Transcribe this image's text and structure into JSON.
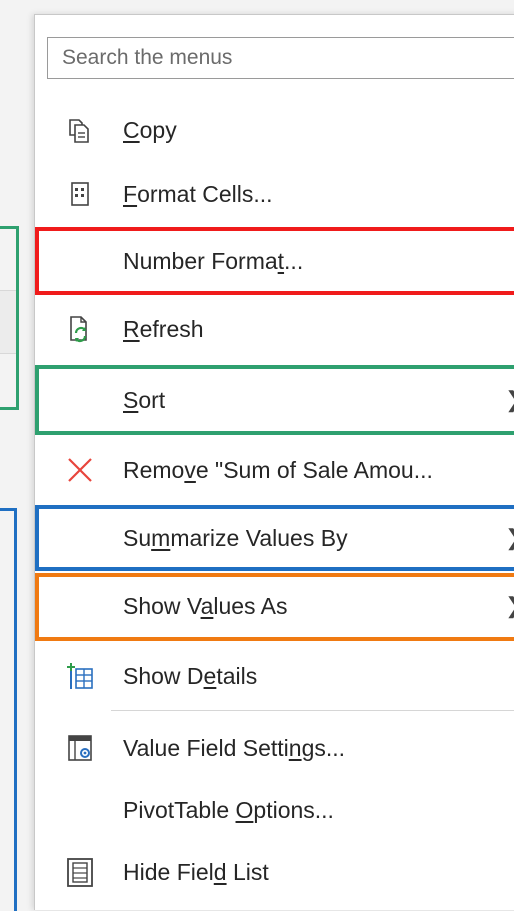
{
  "search": {
    "placeholder": "Search the menus"
  },
  "menu": {
    "copy": {
      "pre": "",
      "u": "C",
      "post": "opy"
    },
    "format_cells": {
      "pre": "",
      "u": "F",
      "post": "ormat Cells..."
    },
    "number_format": {
      "pre": "Number Forma",
      "u": "t",
      "post": "..."
    },
    "refresh": {
      "pre": "",
      "u": "R",
      "post": "efresh"
    },
    "sort": {
      "pre": "",
      "u": "S",
      "post": "ort"
    },
    "remove": {
      "pre": "Remo",
      "u": "v",
      "post": "e \"Sum of Sale Amou..."
    },
    "summarize": {
      "pre": "Su",
      "u": "m",
      "post": "marize Values By"
    },
    "show_values_as": {
      "pre": "Show V",
      "u": "a",
      "post": "lues As"
    },
    "show_details": {
      "pre": "Show D",
      "u": "e",
      "post": "tails"
    },
    "value_field_settings": {
      "pre": "Value Field Setti",
      "u": "n",
      "post": "gs..."
    },
    "pivottable_options": {
      "pre": "PivotTable ",
      "u": "O",
      "post": "ptions..."
    },
    "hide_field_list": {
      "pre": "Hide Fiel",
      "u": "d",
      "post": " List"
    }
  },
  "highlight_colors": {
    "number_format": "#f01b1b",
    "sort": "#2ea06f",
    "summarize": "#1f6fc2",
    "show_values_as": "#f07a12"
  }
}
